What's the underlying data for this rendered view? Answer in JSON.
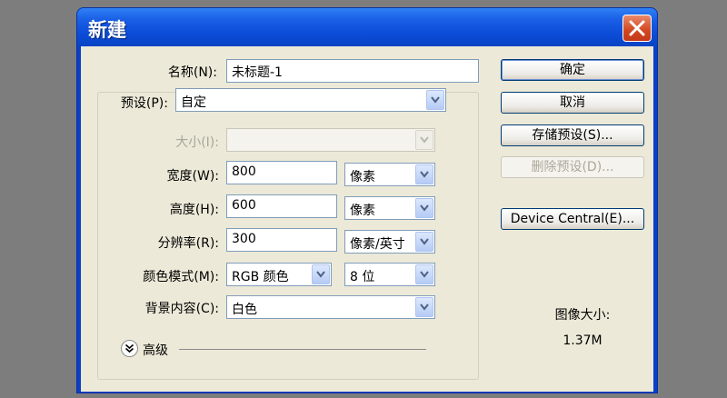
{
  "dialog": {
    "title": "新建",
    "name_label": "名称(N):",
    "name_value": "未标题-1",
    "preset_label": "预设(P):",
    "preset_value": "自定",
    "size_label": "大小(I):",
    "size_value": "",
    "width_label": "宽度(W):",
    "width_value": "800",
    "width_unit": "像素",
    "height_label": "高度(H):",
    "height_value": "600",
    "height_unit": "像素",
    "resolution_label": "分辨率(R):",
    "resolution_value": "300",
    "resolution_unit": "像素/英寸",
    "color_mode_label": "颜色模式(M):",
    "color_mode_value": "RGB 颜色",
    "bit_depth_value": "8 位",
    "background_label": "背景内容(C):",
    "background_value": "白色",
    "advanced_label": "高级",
    "image_size_label": "图像大小:",
    "image_size_value": "1.37M"
  },
  "buttons": {
    "ok": "确定",
    "cancel": "取消",
    "save_preset": "存储预设(S)...",
    "delete_preset": "删除预设(D)...",
    "device_central": "Device Central(E)..."
  },
  "colors": {
    "titlebar": "#0b4bd6",
    "client_bg": "#ece9d8",
    "close_button": "#d2471f"
  },
  "icons": {
    "close": "close-icon",
    "dropdown": "chevron-down-icon",
    "advanced": "double-chevron-down-icon"
  }
}
